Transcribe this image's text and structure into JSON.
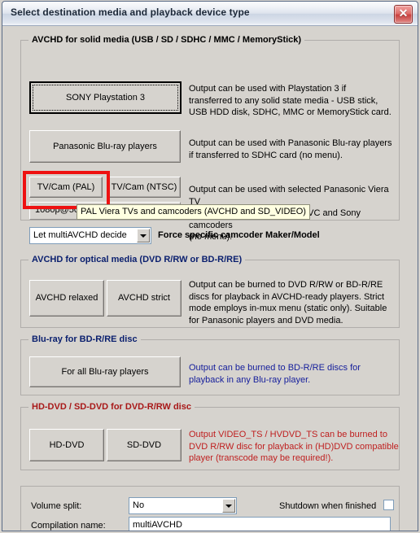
{
  "window": {
    "title": "Select destination media and playback device type",
    "close_label": "✕"
  },
  "sections": {
    "solid": {
      "legend": "AVCHD for solid media (USB / SD / SDHC / MMC / MemoryStick)",
      "ps3_button": "SONY Playstation 3",
      "ps3_desc": "Output can be used with Playstation 3 if\ntransferred to any solid state media - USB stick,\nUSB HDD disk, SDHC, MMC or MemoryStick card.",
      "panasonic_button": "Panasonic Blu-ray players",
      "panasonic_desc": "Output can be used with Panasonic Blu-ray players\nif transferred to SDHC card (no menu).",
      "tvcam_pal_button": "TV/Cam (PAL)",
      "tvcam_ntsc_button": "TV/Cam (NTSC)",
      "tvcam_desc": "Output can be used with selected Panasonic Viera TV\nsets and Canon, Panasonic, JVC and Sony camcoders\n(no menu).",
      "resolution_value": "1080p@50f",
      "maker_combo_value": "Let multiAVCHD decide",
      "maker_label": "Force specific camcoder Maker/Model"
    },
    "optical": {
      "legend": "AVCHD for optical media (DVD R/RW or BD-R/RE)",
      "relaxed_button": "AVCHD relaxed",
      "strict_button": "AVCHD strict",
      "desc": "Output can be burned to DVD R/RW or BD-R/RE\ndiscs for playback in AVCHD-ready players. Strict\nmode employs in-mux menu (static only). Suitable\nfor Panasonic players and DVD media."
    },
    "bluray": {
      "legend": "Blu-ray for BD-R/RE disc",
      "button": "For all Blu-ray players",
      "desc": "Output can be burned to BD-R/RE discs for\nplayback in any Blu-ray player."
    },
    "hddvd": {
      "legend": "HD-DVD / SD-DVD for DVD-R/RW disc",
      "hddvd_button": "HD-DVD",
      "sddvd_button": "SD-DVD",
      "desc": "Output VIDEO_TS / HVDVD_TS can be burned to\nDVD R/RW disc for playback in (HD)DVD compatible\nplayer (transcode may be required!)."
    },
    "footer": {
      "volume_split_label": "Volume split:",
      "volume_split_value": "No",
      "shutdown_label": "Shutdown when finished",
      "compilation_label": "Compilation name:",
      "compilation_value": "multiAVCHD"
    }
  },
  "tooltip": {
    "text": "PAL Viera TVs and camcoders (AVCHD and SD_VIDEO)"
  },
  "colors": {
    "highlight": "#ee1111",
    "legend_blue": "#0a1f6e",
    "legend_red": "#a81818",
    "desc_blue": "#17209c",
    "desc_red": "#bf2020",
    "face": "#d6d3ce",
    "tooltip_bg": "#ffffe1"
  }
}
